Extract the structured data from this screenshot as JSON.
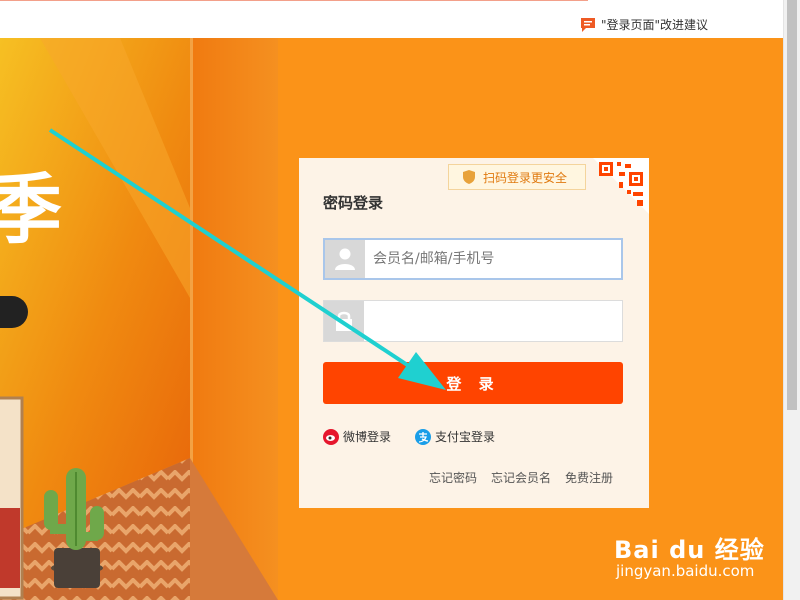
{
  "header": {
    "feedback_text": "\"登录页面\"改进建议"
  },
  "hero": {
    "big_char": "季",
    "small_char": "：",
    "brand_color": "#fb9318"
  },
  "login": {
    "title": "密码登录",
    "qr_tip": "扫码登录更安全",
    "username_placeholder": "会员名/邮箱/手机号",
    "password_placeholder": "",
    "submit_label": "登 录",
    "social": {
      "weibo": "微博登录",
      "alipay": "支付宝登录"
    },
    "links": {
      "forgot_password": "忘记密码",
      "forgot_member": "忘记会员名",
      "register": "免费注册"
    },
    "accent_color": "#ff4400"
  },
  "watermark": {
    "logo_text": "Bai du 经验",
    "sub_text": "jingyan.baidu.com"
  }
}
